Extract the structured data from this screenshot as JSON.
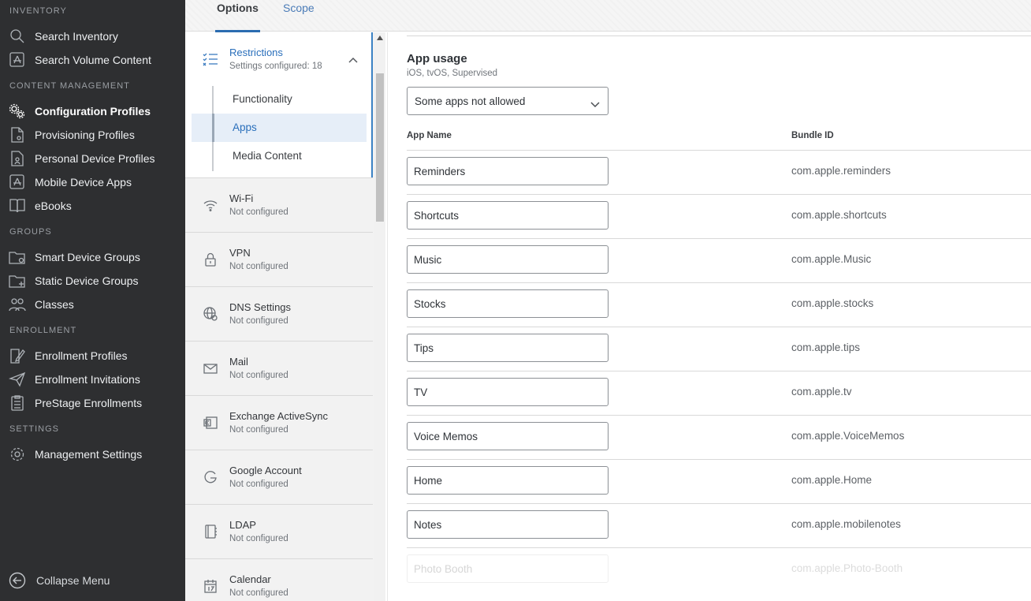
{
  "sidebar": {
    "sections": [
      "INVENTORY",
      "CONTENT MANAGEMENT",
      "GROUPS",
      "ENROLLMENT",
      "SETTINGS"
    ],
    "items": [
      {
        "label": "Search Inventory",
        "icon": "search-icon"
      },
      {
        "label": "Search Volume Content",
        "icon": "app-store-icon"
      },
      {
        "label": "Configuration Profiles",
        "icon": "gears-icon"
      },
      {
        "label": "Provisioning Profiles",
        "icon": "document-icon"
      },
      {
        "label": "Personal Device Profiles",
        "icon": "personal-document-icon"
      },
      {
        "label": "Mobile Device Apps",
        "icon": "app-store-icon"
      },
      {
        "label": "eBooks",
        "icon": "book-icon"
      },
      {
        "label": "Smart Device Groups",
        "icon": "folder-gear-icon"
      },
      {
        "label": "Static Device Groups",
        "icon": "folder-plus-icon"
      },
      {
        "label": "Classes",
        "icon": "people-icon"
      },
      {
        "label": "Enrollment Profiles",
        "icon": "edit-document-icon"
      },
      {
        "label": "Enrollment Invitations",
        "icon": "paper-plane-icon"
      },
      {
        "label": "PreStage Enrollments",
        "icon": "clipboard-icon"
      },
      {
        "label": "Management Settings",
        "icon": "gear-icon"
      }
    ],
    "active_item": "Configuration Profiles",
    "collapse_label": "Collapse Menu"
  },
  "tabs": {
    "options": "Options",
    "scope": "Scope"
  },
  "config_list": {
    "restrictions": {
      "title": "Restrictions",
      "subtitle": "Settings configured: 18",
      "subnav": [
        "Functionality",
        "Apps",
        "Media Content"
      ],
      "active_subnav": "Apps"
    },
    "payloads": [
      {
        "title": "Wi-Fi",
        "status": "Not configured",
        "icon": "wifi-icon"
      },
      {
        "title": "VPN",
        "status": "Not configured",
        "icon": "lock-icon"
      },
      {
        "title": "DNS Settings",
        "status": "Not configured",
        "icon": "globe-gear-icon"
      },
      {
        "title": "Mail",
        "status": "Not configured",
        "icon": "envelope-icon"
      },
      {
        "title": "Exchange ActiveSync",
        "status": "Not configured",
        "icon": "exchange-icon"
      },
      {
        "title": "Google Account",
        "status": "Not configured",
        "icon": "google-icon"
      },
      {
        "title": "LDAP",
        "status": "Not configured",
        "icon": "address-book-icon"
      },
      {
        "title": "Calendar",
        "status": "Not configured",
        "icon": "calendar-icon"
      }
    ]
  },
  "app_usage": {
    "title": "App usage",
    "subtitle": "iOS, tvOS, Supervised",
    "selected": "Some apps not allowed",
    "columns": {
      "app_name": "App Name",
      "bundle_id": "Bundle ID"
    },
    "rows": [
      {
        "app": "Reminders",
        "bundle": "com.apple.reminders"
      },
      {
        "app": "Shortcuts",
        "bundle": "com.apple.shortcuts"
      },
      {
        "app": "Music",
        "bundle": "com.apple.Music"
      },
      {
        "app": "Stocks",
        "bundle": "com.apple.stocks"
      },
      {
        "app": "Tips",
        "bundle": "com.apple.tips"
      },
      {
        "app": "TV",
        "bundle": "com.apple.tv"
      },
      {
        "app": "Voice Memos",
        "bundle": "com.apple.VoiceMemos"
      },
      {
        "app": "Home",
        "bundle": "com.apple.Home"
      },
      {
        "app": "Notes",
        "bundle": "com.apple.mobilenotes"
      },
      {
        "app": "Photo Booth",
        "bundle": "com.apple.Photo-Booth"
      }
    ]
  },
  "colors": {
    "sidebar_bg": "#2e2f31",
    "accent": "#2a6fbb",
    "active_subnav_bg": "#e6eef8"
  }
}
